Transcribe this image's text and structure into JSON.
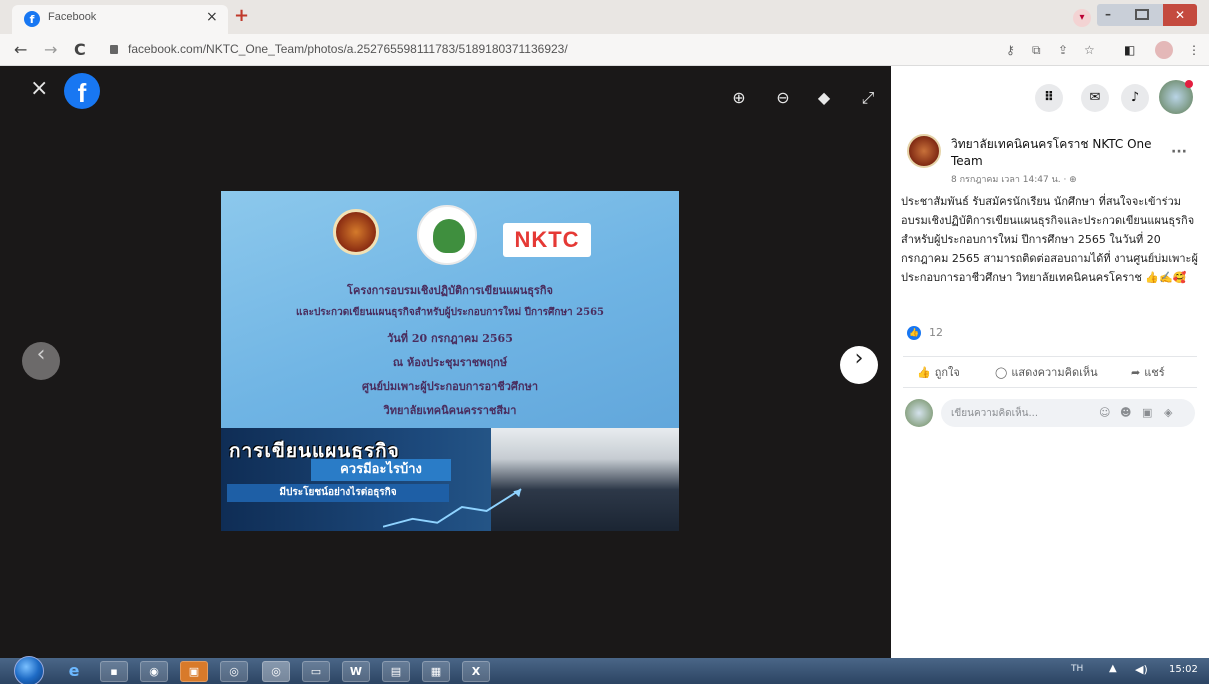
{
  "browser": {
    "tab_title": "Facebook",
    "tab_close": "×",
    "new_tab": "+",
    "url": "facebook.com/NKTC_One_Team/photos/a.252765598111783/5189180371136923/",
    "back": "←",
    "forward": "→",
    "reload": "C"
  },
  "viewer": {
    "close": "×",
    "logo": "f",
    "prev": "‹",
    "next": "›",
    "tools": {
      "zoom_in": "⊕",
      "zoom_out": "⊖",
      "tag": "◆",
      "fullscreen": "⤢"
    }
  },
  "poster": {
    "logo_text": "NKTC",
    "lines": [
      "โครงการอบรมเชิงปฏิบัติการเขียนแผนธุรกิจ",
      "และประกวดเขียนแผนธุรกิจสำหรับผู้ประกอบการใหม่ ปีการศึกษา 2565",
      "วันที่ 20 กรกฎาคม 2565",
      "ณ ห้องประชุมราชพฤกษ์",
      "ศูนย์บ่มเพาะผู้ประกอบการอาชีวศึกษา",
      "วิทยาลัยเทคนิคนครราชสีมา"
    ],
    "headline": "การเขียนแผนธุรกิจ",
    "subheadline": "ควรมีอะไรบ้าง",
    "tagline": "มีประโยชน์อย่างไรต่อธุรกิจ"
  },
  "post": {
    "page_name": "วิทยาลัยเทคนิคนครโคราช NKTC One Team",
    "timestamp": "8 กรกฎาคม เวลา 14:47 น. · ⊕",
    "more": "···",
    "text": "ประชาสัมพันธ์ รับสมัครนักเรียน นักศึกษา ที่สนใจจะเข้าร่วมอบรมเชิงปฏิบัติการเขียนแผนธุรกิจและประกวดเขียนแผนธุรกิจสำหรับผู้ประกอบการใหม่ ปีการศึกษา 2565 ในวันที่ 20 กรกฎาคม 2565 สามารถติดต่อสอบถามได้ที่ งานศูนย์บ่มเพาะผู้ประกอบการอาชีวศึกษา วิทยาลัยเทคนิคนครโคราช 👍✍️🥰",
    "like_count": "12",
    "like_label": "ถูกใจ",
    "comment_label": "แสดงความคิดเห็น",
    "share_label": "แชร์",
    "comment_placeholder": "เขียนความคิดเห็น..."
  },
  "taskbar": {
    "lang": "TH",
    "time": "15:02"
  }
}
